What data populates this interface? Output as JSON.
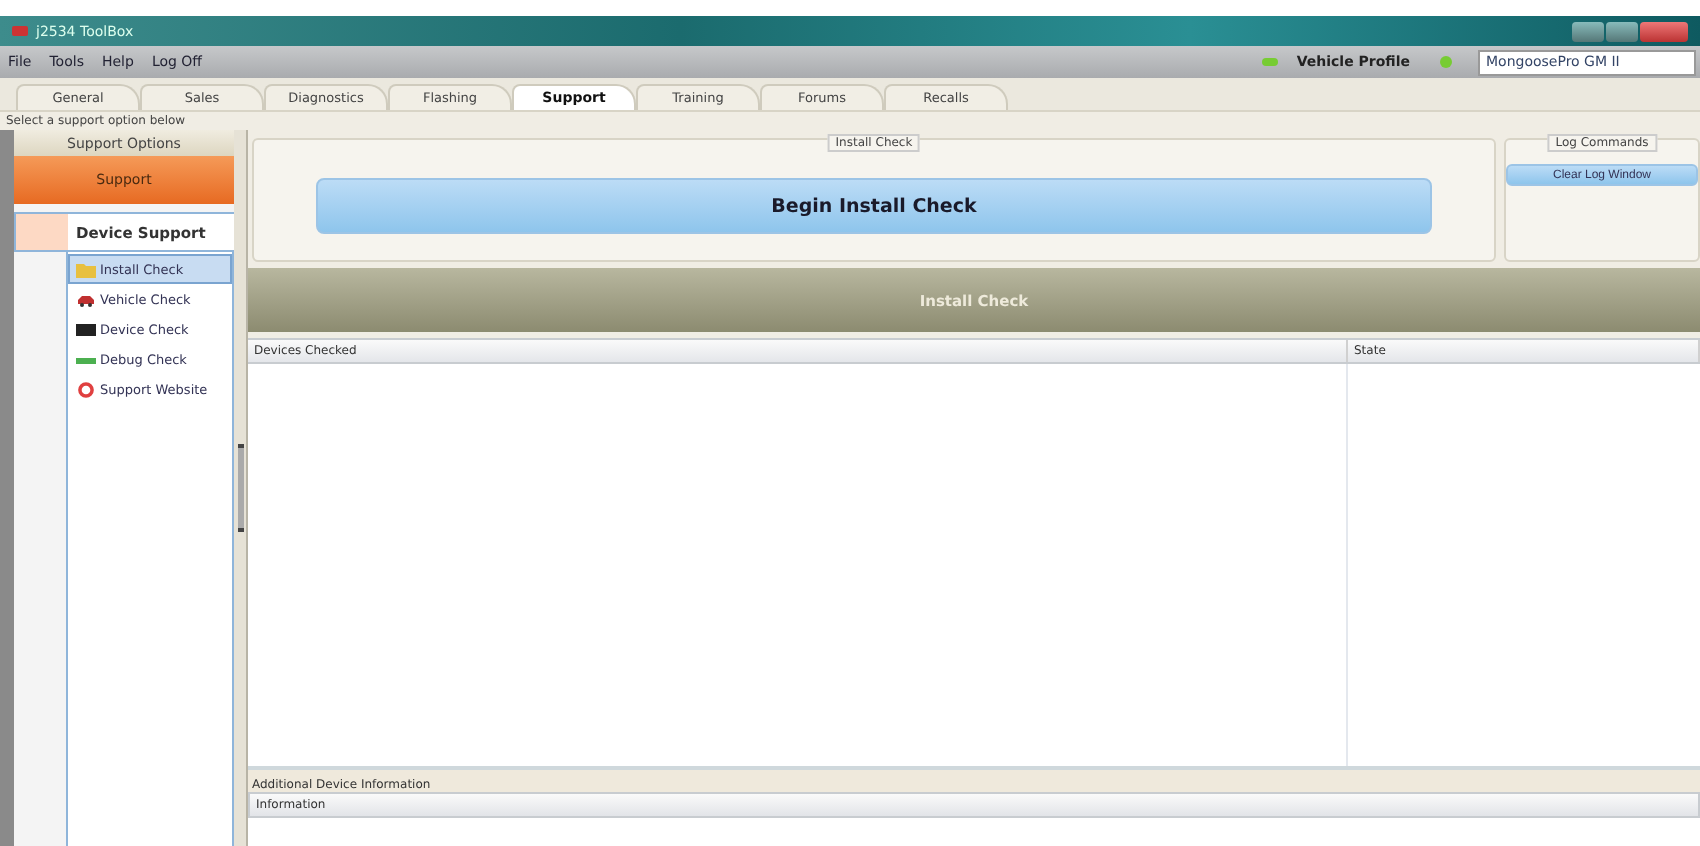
{
  "window": {
    "title": "j2534 ToolBox"
  },
  "menu": [
    "File",
    "Tools",
    "Help",
    "Log Off"
  ],
  "vehicle_profile": {
    "label": "Vehicle Profile",
    "device": "MongoosePro GM II"
  },
  "tabs": [
    {
      "label": "General",
      "selected": false
    },
    {
      "label": "Sales",
      "selected": false
    },
    {
      "label": "Diagnostics",
      "selected": false
    },
    {
      "label": "Flashing",
      "selected": false
    },
    {
      "label": "Support",
      "selected": true
    },
    {
      "label": "Training",
      "selected": false
    },
    {
      "label": "Forums",
      "selected": false
    },
    {
      "label": "Recalls",
      "selected": false
    }
  ],
  "hint": "Select a support option below",
  "sidebar": {
    "options_header": "Support Options",
    "section": "Support",
    "group": "Device Support",
    "items": [
      {
        "label": "Install Check",
        "selected": true,
        "kind": "folder"
      },
      {
        "label": "Vehicle Check",
        "selected": false,
        "kind": "car"
      },
      {
        "label": "Device Check",
        "selected": false,
        "kind": "monitor"
      },
      {
        "label": "Debug Check",
        "selected": false,
        "kind": "bar"
      },
      {
        "label": "Support Website",
        "selected": false,
        "kind": "lifebuoy"
      }
    ]
  },
  "install_panel": {
    "legend": "Install Check",
    "button": "Begin Install Check"
  },
  "log_panel": {
    "legend": "Log Commands",
    "button": "Clear Log Window"
  },
  "banner": "Install Check",
  "table": {
    "columns": [
      "Devices Checked",
      "State"
    ]
  },
  "additional": {
    "title": "Additional Device Information",
    "columns": [
      "Information"
    ]
  }
}
